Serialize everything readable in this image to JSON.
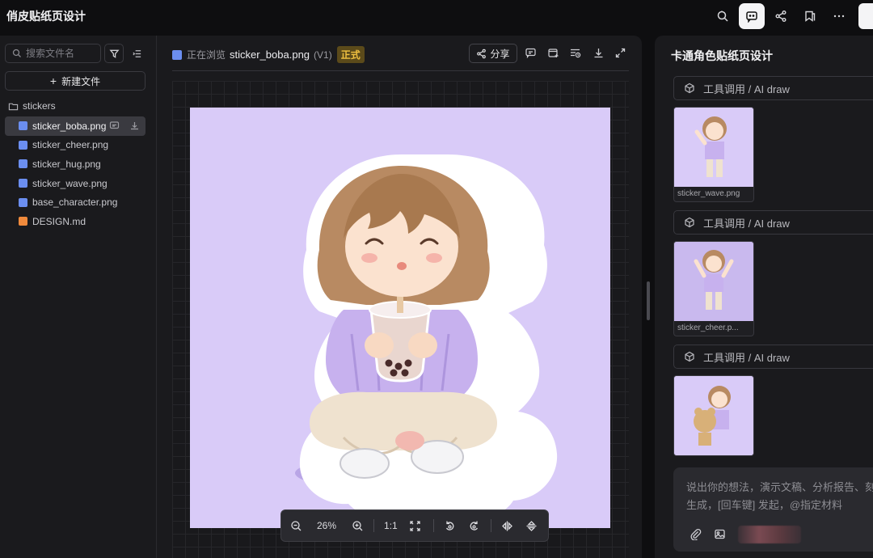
{
  "app": {
    "title": "俏皮贴纸页设计"
  },
  "topbar": {
    "icons": [
      "search-refresh-icon",
      "chat-icon",
      "share-icon",
      "bookmark-icon",
      "more-icon"
    ]
  },
  "files": {
    "search_placeholder": "搜索文件名",
    "new_file_label": "新建文件",
    "folder": "stickers",
    "items": [
      {
        "name": "sticker_boba.png",
        "type": "image",
        "selected": true
      },
      {
        "name": "sticker_cheer.png",
        "type": "image"
      },
      {
        "name": "sticker_hug.png",
        "type": "image"
      },
      {
        "name": "sticker_wave.png",
        "type": "image"
      },
      {
        "name": "base_character.png",
        "type": "image"
      },
      {
        "name": "DESIGN.md",
        "type": "markdown"
      }
    ]
  },
  "viewer": {
    "browsing_label": "正在浏览",
    "file_name": "sticker_boba.png",
    "version": "(V1)",
    "status_badge": "正式",
    "share_label": "分享",
    "zoom_level": "26%",
    "actual_size_label": "1:1"
  },
  "chat": {
    "title": "卡通角色贴纸页设计",
    "tool_call_label": "工具调用 / AI draw",
    "results": [
      {
        "file": "sticker_wave.png"
      },
      {
        "file": "sticker_cheer.p..."
      },
      {
        "file": ""
      }
    ],
    "input_placeholder": "说出你的想法，演示文稿、分析报告、刻生成，[回车键] 发起，@指定材料"
  },
  "colors": {
    "accent_badge": "#f0c040",
    "canvas_bg": "#d9cbf8",
    "image_icon": "#6b8ef0",
    "md_icon": "#f08a3c"
  }
}
